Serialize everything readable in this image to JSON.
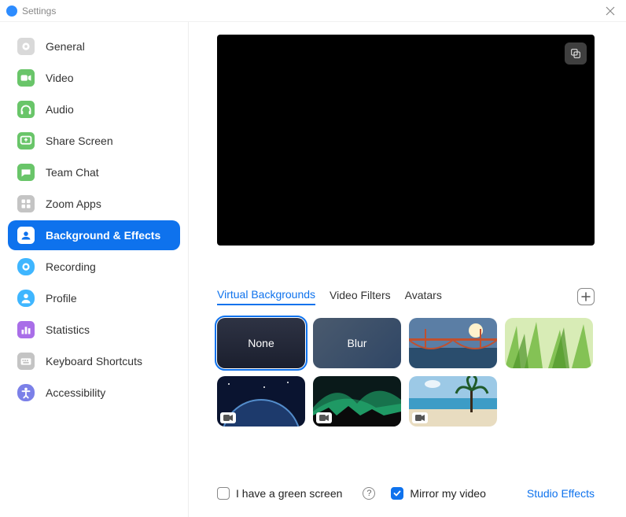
{
  "window": {
    "title": "Settings"
  },
  "sidebar": {
    "items": [
      {
        "label": "General"
      },
      {
        "label": "Video"
      },
      {
        "label": "Audio"
      },
      {
        "label": "Share Screen"
      },
      {
        "label": "Team Chat"
      },
      {
        "label": "Zoom Apps"
      },
      {
        "label": "Background & Effects"
      },
      {
        "label": "Recording"
      },
      {
        "label": "Profile"
      },
      {
        "label": "Statistics"
      },
      {
        "label": "Keyboard Shortcuts"
      },
      {
        "label": "Accessibility"
      }
    ]
  },
  "tabs": {
    "virtual_backgrounds": "Virtual Backgrounds",
    "video_filters": "Video Filters",
    "avatars": "Avatars"
  },
  "backgrounds": {
    "none": "None",
    "blur": "Blur"
  },
  "options": {
    "green_screen": "I have a green screen",
    "mirror": "Mirror my video",
    "studio_effects": "Studio Effects"
  }
}
